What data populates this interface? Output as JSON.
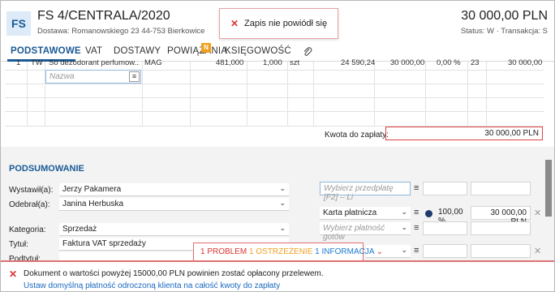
{
  "header": {
    "badge": "FS",
    "title": "FS 4/CENTRALA/2020",
    "address": "Dostawa: Romanowskiego 23  44-753 Bierkowice",
    "amount": "30 000,00 PLN",
    "status": "Status: W  ·  Transakcja: S"
  },
  "toast": {
    "message": "Zapis nie powiódł się"
  },
  "tabs": [
    "PODSTAWOWE",
    "VAT",
    "DOSTAWY",
    "POWIĄZANIA",
    "KSIĘGOWOŚĆ"
  ],
  "tab_badge": "N",
  "grid": {
    "row": [
      "1",
      "TW",
      "So dezodorant perfumow...",
      "MAG",
      "481,000",
      "1,000",
      "szt",
      "24 590,24",
      "30 000,00",
      "0,00 %",
      "23",
      "30 000,00"
    ],
    "name_placeholder": "Nazwa"
  },
  "kwota": {
    "label": "Kwota do zapłaty:",
    "value": "30 000,00 PLN"
  },
  "summary": {
    "title": "PODSUMOWANIE",
    "labels": [
      "Wystawił(a):",
      "Odebrał(a):",
      "Kategoria:",
      "Tytuł:",
      "Podtytuł:"
    ],
    "values": [
      "Jerzy Pakamera",
      "Janina Herbuska",
      "Sprzedaż",
      "Faktura VAT sprzedaży",
      ""
    ],
    "prepay_placeholder": "Wybierz przedpłatę [F2] – Li",
    "payment_method": "Karta płatnicza",
    "percent": "100,00 %",
    "pay_amount": "30 000,00 PLN",
    "other_pay_placeholder": "Wybierz płatność gotów"
  },
  "problems": {
    "p1": "1 PROBLEM",
    "p2": "1 OSTRZEŻENIE",
    "p3": "1 INFORMACJA"
  },
  "footer": {
    "message": "Dokument o wartości powyżej 15000,00 PLN powinien zostać opłacony przelewem.",
    "link": "Ustaw domyślną płatność odroczoną klienta na całość kwoty do zapłaty"
  }
}
